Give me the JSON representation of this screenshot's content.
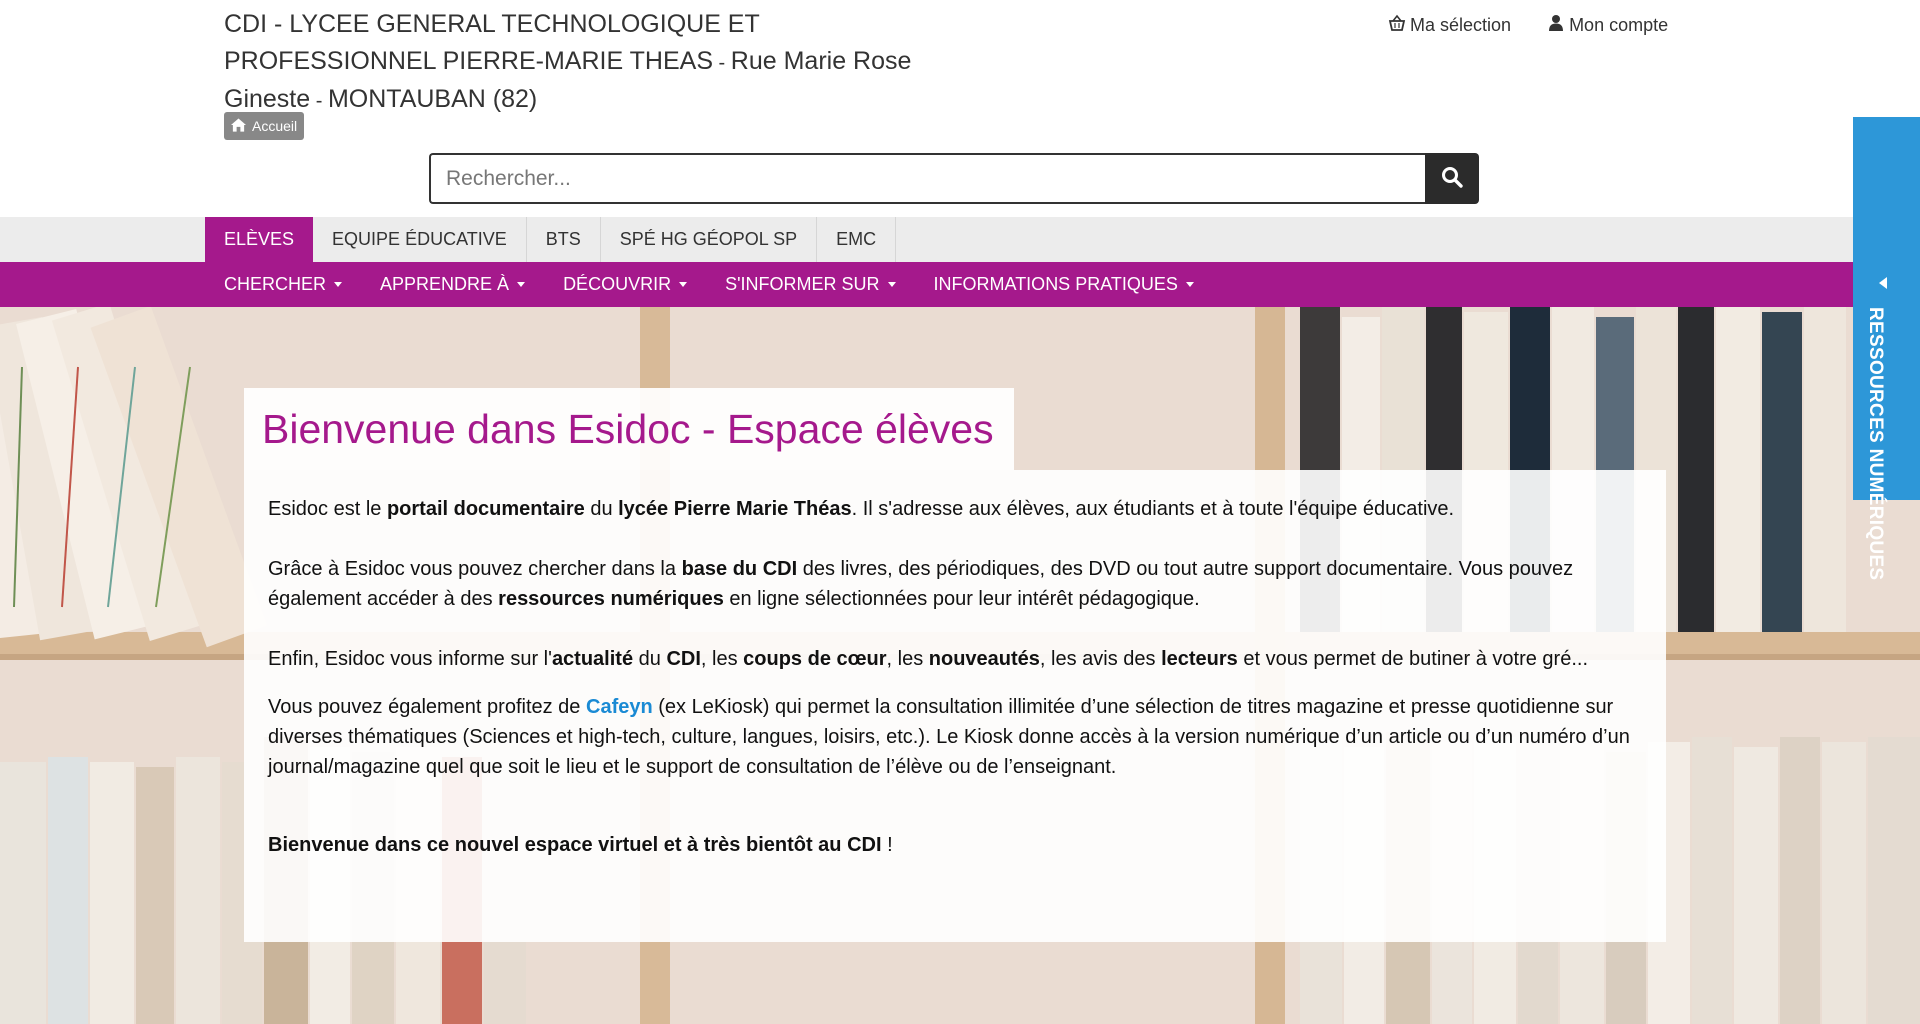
{
  "header": {
    "school_name": "CDI - LYCEE GENERAL TECHNOLOGIQUE ET PROFESSIONNEL PIERRE-MARIE THEAS",
    "separator": " - ",
    "street": "Rue Marie Rose Gineste",
    "city": "MONTAUBAN (82)",
    "home_label": "Accueil",
    "selection_label": "Ma sélection",
    "account_label": "Mon compte"
  },
  "search": {
    "placeholder": "Rechercher..."
  },
  "tabs": [
    {
      "label": "ELÈVES",
      "active": true
    },
    {
      "label": "EQUIPE ÉDUCATIVE"
    },
    {
      "label": "BTS"
    },
    {
      "label": "SPÉ HG GÉOPOL SP"
    },
    {
      "label": "EMC"
    }
  ],
  "menu": [
    {
      "label": "CHERCHER"
    },
    {
      "label": "APPRENDRE À"
    },
    {
      "label": "DÉCOUVRIR"
    },
    {
      "label": "S'INFORMER SUR"
    },
    {
      "label": "INFORMATIONS PRATIQUES"
    }
  ],
  "content": {
    "title": "Bienvenue dans Esidoc - Espace élèves",
    "p1": [
      "Esidoc est le ",
      "portail documentaire",
      " du ",
      "lycée Pierre Marie Théas",
      ". Il s'adresse aux élèves, aux étudiants et à toute l'équipe éducative."
    ],
    "p2": [
      "Grâce à Esidoc vous pouvez chercher dans la ",
      "base du CDI",
      " des livres, des périodiques, des DVD ou tout autre support documentaire. Vous pouvez également accéder à des ",
      "ressources numériques",
      " en ligne sélectionnées pour leur intérêt pédagogique."
    ],
    "p3": [
      "Enfin, Esidoc vous informe sur l'",
      "actualité",
      " du ",
      "CDI",
      ", les ",
      "coups de cœur",
      ", les ",
      "nouveautés",
      ", les avis des ",
      "lecteurs",
      " et vous permet de butiner à votre gré..."
    ],
    "p4": [
      "Vous pouvez également profitez de ",
      "Cafeyn",
      " (ex LeKiosk) qui permet la consultation illimitée d’une sélection de titres magazine et presse quotidienne sur diverses thématiques (Sciences et high-tech, culture, langues, loisirs, etc.). Le Kiosk donne accès à la version numérique d’un article ou d’un numéro d’un journal/magazine quel que soit le lieu et le support de consultation de l’élève ou de l’enseignant."
    ],
    "p5": [
      "Bienvenue dans ce nouvel espace virtuel et à très bientôt au CDI",
      " !"
    ]
  },
  "side_tab": {
    "label": "RESSOURCES NUMÉRIQUES"
  },
  "colors": {
    "brand_purple": "#a5198c",
    "side_tab_blue": "#2d97d8",
    "link_blue": "#1a8ad4"
  },
  "icons": [
    "home-icon",
    "basket-icon",
    "user-icon",
    "search-icon",
    "caret-down-icon",
    "caret-left-icon"
  ]
}
